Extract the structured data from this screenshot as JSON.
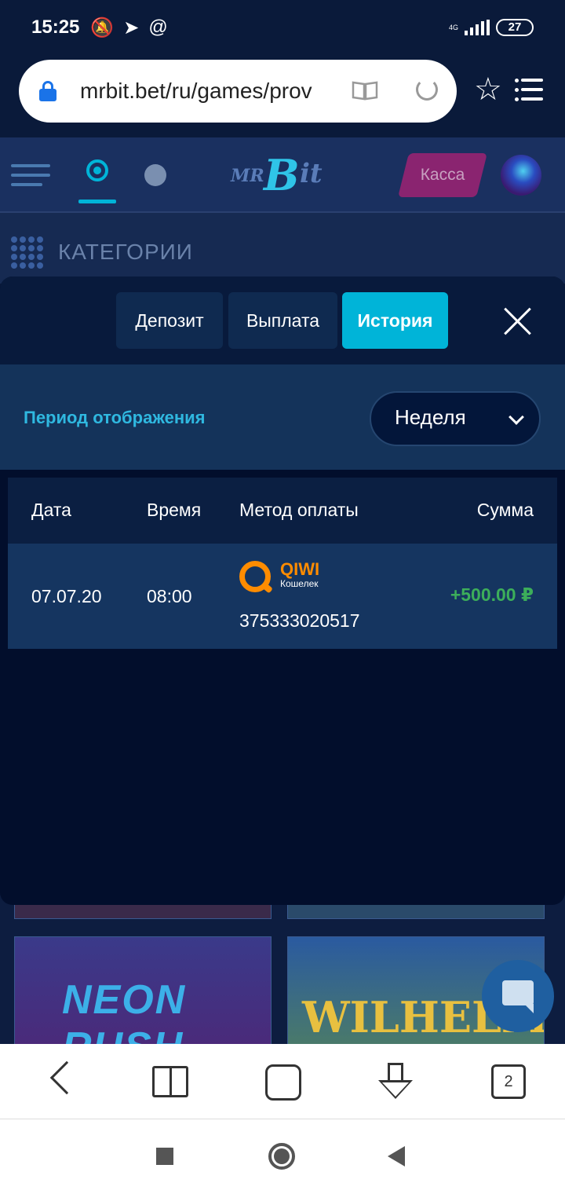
{
  "status_bar": {
    "time": "15:25",
    "network": "4G",
    "battery": "27",
    "icons": [
      "bell-off-icon",
      "telegram-icon",
      "at-icon"
    ]
  },
  "browser": {
    "url": "mrbit.bet/ru/games/prov",
    "tab_count": "2"
  },
  "site": {
    "logo_mr": "MR",
    "logo_b": "B",
    "logo_it": "it",
    "kassa_label": "Касса",
    "categories_title": "КАТЕГОРИИ"
  },
  "modal": {
    "tabs": [
      {
        "label": "Депозит",
        "active": false
      },
      {
        "label": "Выплата",
        "active": false
      },
      {
        "label": "История",
        "active": true
      }
    ],
    "period_label": "Период отображения",
    "period_value": "Неделя",
    "table": {
      "headers": [
        "Дата",
        "Время",
        "Метод оплаты",
        "Сумма"
      ],
      "rows": [
        {
          "date": "07.07.20",
          "time": "08:00",
          "method_name": "QIWI",
          "method_sub": "Кошелек",
          "account": "375333020517",
          "amount": "+500.00 ₽"
        }
      ]
    }
  },
  "background_games": {
    "tile_left_title": "NEON RUSH",
    "tile_right_title": "WILHELM TELL"
  },
  "colors": {
    "accent": "#00b4d8",
    "amount_positive": "#3cae5a",
    "qiwi": "#ff8c00",
    "modal_bg": "#020e2c"
  }
}
